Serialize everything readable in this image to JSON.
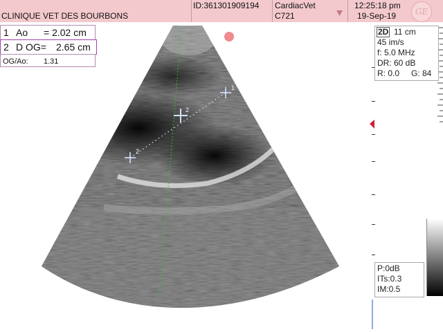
{
  "header": {
    "clinic_name": "CLINIQUE VET DES BOURBONS",
    "patient_id": "ID:361301909194",
    "app_name": "CardiacVet",
    "probe": "C721",
    "time": "12:25:18 pm",
    "date": "19-Sep-19",
    "logo": "ge-logo"
  },
  "measurements": [
    {
      "index": "1",
      "label": "Ao",
      "value": "= 2.02 cm"
    },
    {
      "index": "2",
      "label": "D OG=",
      "value": "2.65 cm"
    }
  ],
  "ratio": {
    "label": "OG/Ao:",
    "value": "1.31"
  },
  "calipers": [
    {
      "label": "1"
    },
    {
      "label": "2"
    },
    {
      "label": "2"
    }
  ],
  "params_top": {
    "mode": "2D",
    "depth": "11 cm",
    "frame_rate": "45 im/s",
    "frequency": "f: 5.0 MHz",
    "dynamic_range": "DR: 60 dB",
    "reject": "R: 0.0",
    "gain": "G: 84"
  },
  "params_bottom": {
    "power": "P:0dB",
    "its": "ITs:0.3",
    "mi": "IM:0.5"
  },
  "colors": {
    "header_bg": "#f3c9cd",
    "caliper": "#cfe3ff",
    "guide_line": "#35c335",
    "focus_marker": "#d0203a"
  }
}
